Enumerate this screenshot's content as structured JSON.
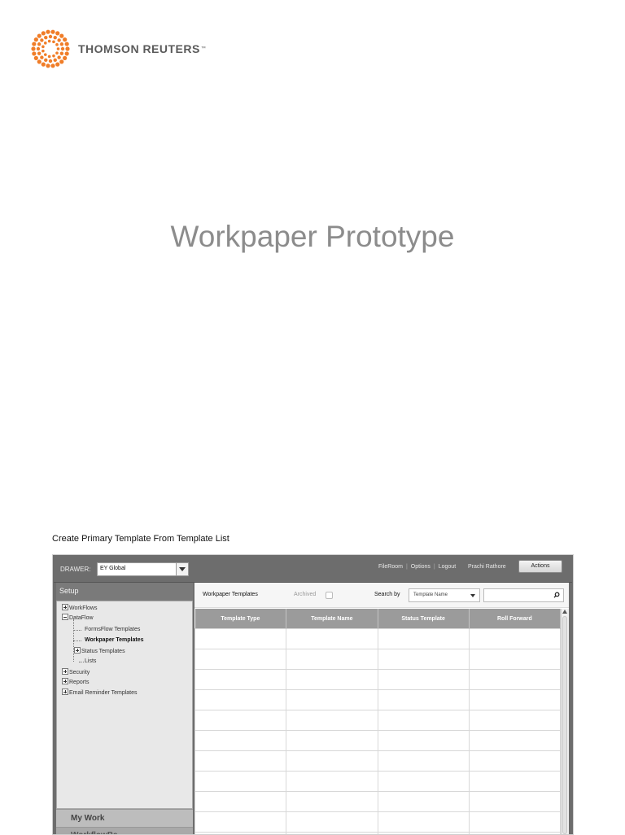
{
  "brand": {
    "name": "THOMSON REUTERS",
    "tm": "™",
    "logo_icon": "dotted-sphere-logo",
    "color": "#f07d28"
  },
  "page_title": "Workpaper Prototype",
  "section_caption": "Create Primary Template From Template List",
  "app": {
    "drawer_label": "DRAWER:",
    "drawer_value": "EY Global",
    "top_links": [
      "FileRoom",
      "Options",
      "Logout"
    ],
    "user_name": "Prachi Rathore",
    "actions_label": "Actions",
    "sidebar": {
      "header": "Setup",
      "tree": {
        "workflows": "WorkFlows",
        "dataflow": "DataFlow",
        "formsflow_templates": "FormsFlow Templates",
        "workpaper_templates": "Workpaper Templates",
        "status_templates": "Status Templates",
        "lists": "Lists",
        "security": "Security",
        "reports": "Reports",
        "email_reminder_templates": "Email Reminder Templates"
      },
      "nav_my_work": "My Work",
      "nav_next": "WorkflowBa"
    },
    "filter": {
      "title": "Workpaper Templates",
      "archived_label": "Archived",
      "archived_checked": false,
      "search_by_label": "Search by",
      "search_by_value": "Template Name",
      "search_value": ""
    },
    "table": {
      "columns": [
        "Template Type",
        "Template Name",
        "Status Template",
        "Roll Forward"
      ],
      "row_count": 11
    }
  }
}
